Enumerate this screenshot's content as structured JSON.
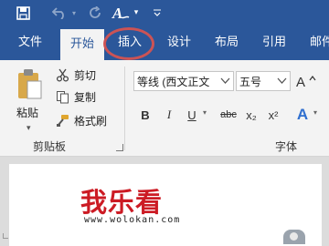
{
  "qat": {
    "save_icon": "save-icon",
    "undo_icon": "undo-icon",
    "redo_icon": "redo-icon",
    "format_icon": "text-format-icon",
    "customize_icon": "customize-qat-icon"
  },
  "tabs": [
    {
      "label": "文件"
    },
    {
      "label": "开始",
      "active": true
    },
    {
      "label": "插入",
      "highlighted": true
    },
    {
      "label": "设计"
    },
    {
      "label": "布局"
    },
    {
      "label": "引用"
    },
    {
      "label": "邮件"
    }
  ],
  "clipboard": {
    "paste_label": "粘贴",
    "cut_label": "剪切",
    "copy_label": "复制",
    "format_painter_label": "格式刷",
    "group_label": "剪贴板"
  },
  "font": {
    "font_name": "等线 (西文正文",
    "font_size": "五号",
    "group_label": "字体",
    "bold": "B",
    "italic": "I",
    "underline": "U",
    "strikethrough": "abc",
    "subscript": "x₂",
    "superscript": "x²",
    "text_effects": "A"
  },
  "document": {
    "watermark_title": "我乐看",
    "watermark_url": "www.wolokan.com"
  },
  "colors": {
    "ribbon_blue": "#2b579a",
    "ribbon_bg": "#f3f3f3",
    "highlight_red": "#d9534f",
    "watermark_red": "#cc1b24"
  }
}
